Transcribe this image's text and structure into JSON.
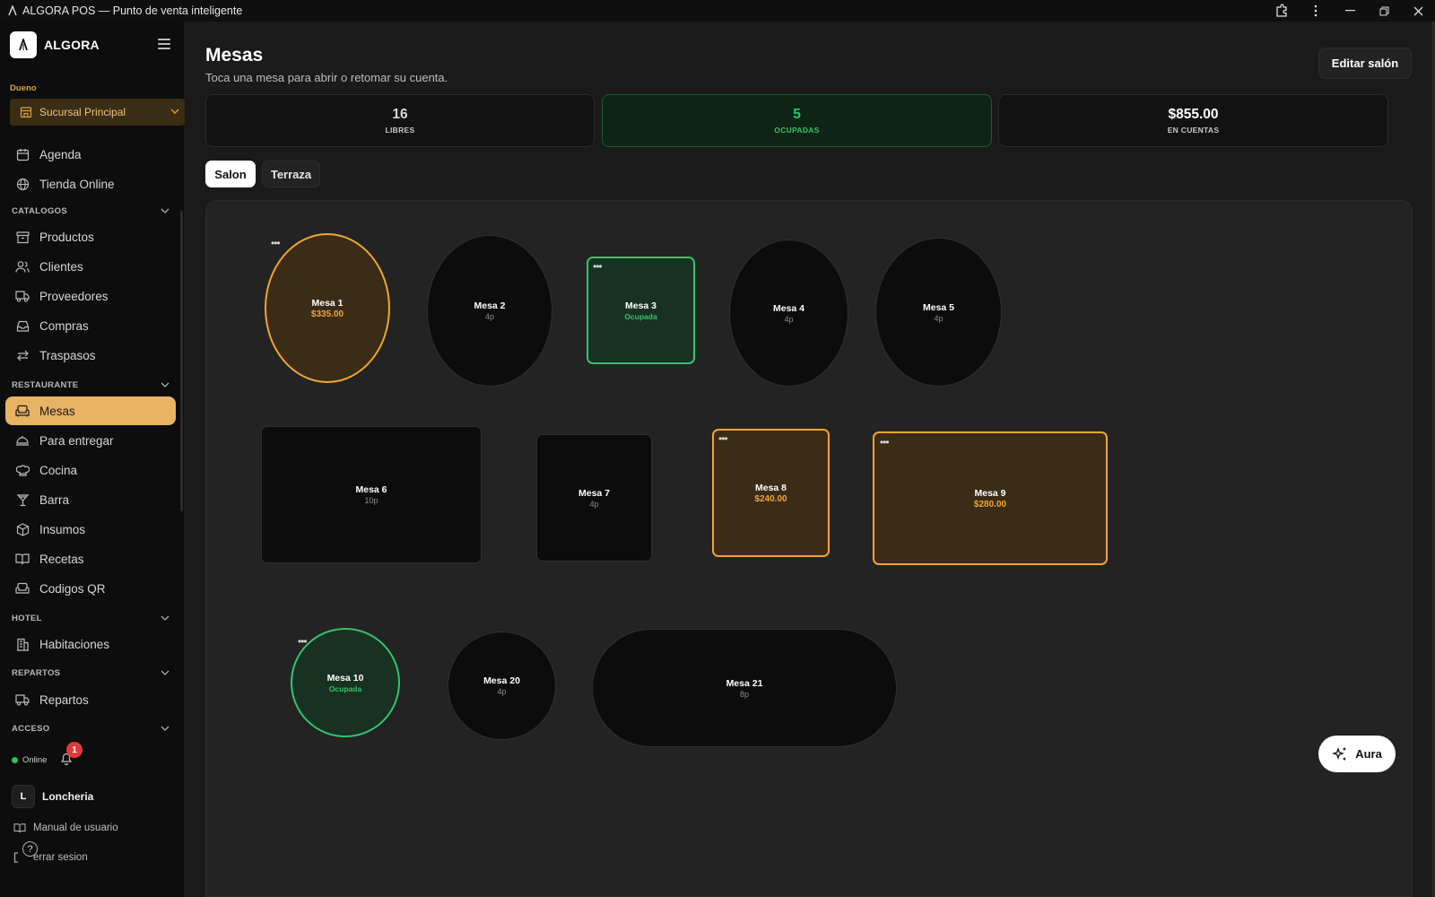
{
  "window": {
    "title": "ALGORA POS — Punto de venta inteligente"
  },
  "sidebar": {
    "brand": "ALGORA",
    "role": "Dueno",
    "branch": "Sucursal Principal",
    "top_items": [
      {
        "label": "Agenda",
        "icon": "calendar-icon"
      },
      {
        "label": "Tienda Online",
        "icon": "globe-icon"
      }
    ],
    "sections": {
      "catalogos": "CATALOGOS",
      "restaurante": "RESTAURANTE",
      "hotel": "HOTEL",
      "repartos": "REPARTOS",
      "acceso": "ACCESO"
    },
    "catalogos_items": [
      {
        "label": "Productos",
        "icon": "archive-icon"
      },
      {
        "label": "Clientes",
        "icon": "users-icon"
      },
      {
        "label": "Proveedores",
        "icon": "truck-icon"
      },
      {
        "label": "Compras",
        "icon": "inbox-icon"
      },
      {
        "label": "Traspasos",
        "icon": "transfer-icon"
      }
    ],
    "restaurante_items": [
      {
        "label": "Mesas",
        "icon": "sofa-icon",
        "active": true
      },
      {
        "label": "Para entregar",
        "icon": "dish-icon"
      },
      {
        "label": "Cocina",
        "icon": "chef-hat-icon"
      },
      {
        "label": "Barra",
        "icon": "cocktail-icon"
      },
      {
        "label": "Insumos",
        "icon": "box-icon"
      },
      {
        "label": "Recetas",
        "icon": "book-icon"
      },
      {
        "label": "Codigos QR",
        "icon": "qr-icon"
      }
    ],
    "hotel_items": [
      {
        "label": "Habitaciones",
        "icon": "building-icon"
      }
    ],
    "repartos_items": [
      {
        "label": "Repartos",
        "icon": "truck-icon"
      }
    ],
    "status": "Online",
    "notifications": "1",
    "user": {
      "initial": "L",
      "name": "Loncheria"
    },
    "manual": "Manual de usuario",
    "logout": "errar sesion",
    "help": "?"
  },
  "main": {
    "title": "Mesas",
    "subtitle": "Toca una mesa para abrir o retomar su cuenta.",
    "edit_button": "Editar salón",
    "stats": [
      {
        "value": "16",
        "label": "LIBRES"
      },
      {
        "value": "5",
        "label": "OCUPADAS"
      },
      {
        "value": "$855.00",
        "label": "EN CUENTAS"
      }
    ],
    "tabs": [
      "Salon",
      "Terraza"
    ],
    "tables": [
      {
        "name": "Mesa 1",
        "sub": "$335.00",
        "state": "amber"
      },
      {
        "name": "Mesa 2",
        "sub": "4p",
        "state": "free"
      },
      {
        "name": "Mesa 3",
        "sub": "Ocupada",
        "state": "green"
      },
      {
        "name": "Mesa 4",
        "sub": "4p",
        "state": "free"
      },
      {
        "name": "Mesa 5",
        "sub": "4p",
        "state": "free"
      },
      {
        "name": "Mesa 6",
        "sub": "10p",
        "state": "free"
      },
      {
        "name": "Mesa 7",
        "sub": "4p",
        "state": "free"
      },
      {
        "name": "Mesa 8",
        "sub": "$240.00",
        "state": "amber"
      },
      {
        "name": "Mesa 9",
        "sub": "$280.00",
        "state": "amber"
      },
      {
        "name": "Mesa 10",
        "sub": "Ocupada",
        "state": "green"
      },
      {
        "name": "Mesa 20",
        "sub": "4p",
        "state": "free"
      },
      {
        "name": "Mesa 21",
        "sub": "8p",
        "state": "free"
      }
    ],
    "more_glyph": "•••",
    "aura_button": "Aura"
  },
  "colors": {
    "accent_amber": "#f2a531",
    "active_nav": "#e8b365",
    "occupied_green": "#33c46a",
    "notification_red": "#e03b3b"
  }
}
